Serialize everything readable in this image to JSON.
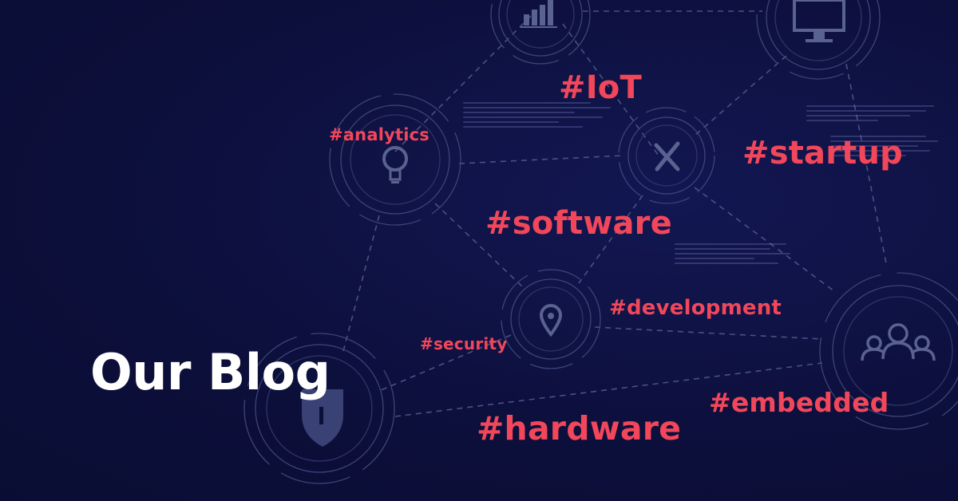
{
  "colors": {
    "background": "#0c0f3a",
    "accent": "#f2475a",
    "title": "#ffffff",
    "network_line": "#4a5183",
    "icon": "#5a628f"
  },
  "title": "Our Blog",
  "tags": {
    "iot": "#IoT",
    "analytics": "#analytics",
    "startup": "#startup",
    "software": "#software",
    "development": "#development",
    "security": "#security",
    "embedded": "#embedded",
    "hardware": "#hardware"
  },
  "icons": {
    "chart": "bar-chart-icon",
    "monitor": "monitor-icon",
    "lightbulb": "lightbulb-icon",
    "tools": "tools-icon",
    "location": "location-pin-icon",
    "shield": "shield-icon",
    "people": "people-group-icon"
  }
}
